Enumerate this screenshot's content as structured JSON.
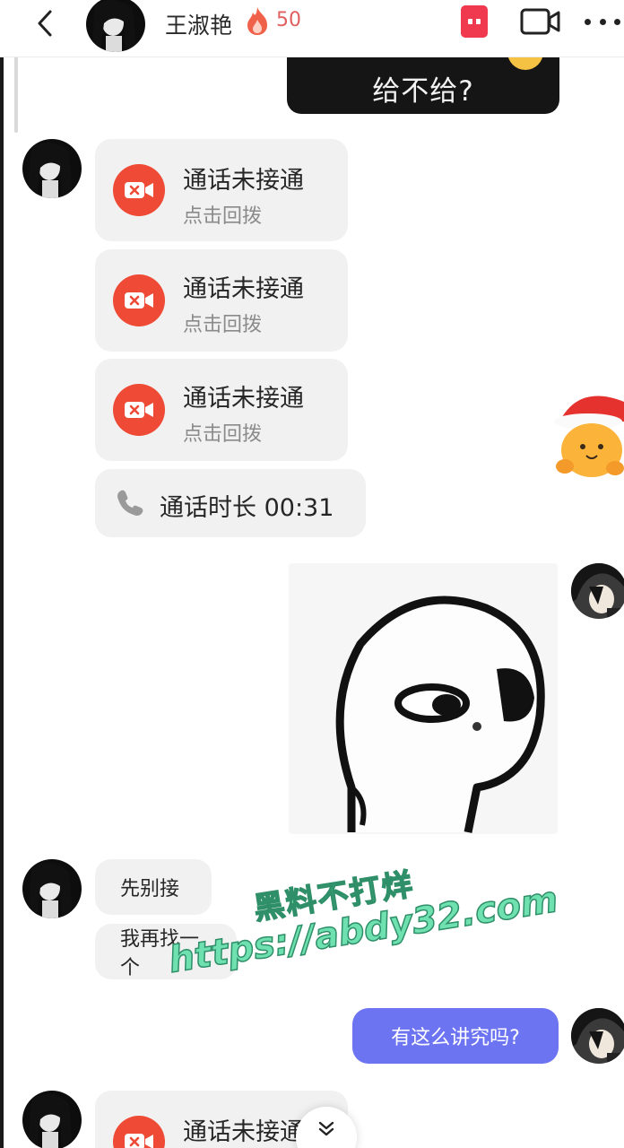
{
  "header": {
    "contact_name": "王淑艳",
    "streak_count": "50",
    "icons": [
      "back-icon",
      "fire-icon",
      "red-packet-icon",
      "video-call-icon",
      "more-icon"
    ]
  },
  "messages": {
    "outgoing_dark": "给不给?",
    "missed_call_title": "通话未接通",
    "missed_call_sub": "点击回拨",
    "duration_label": "通话时长 00:31",
    "incoming_text_1": "先别接",
    "incoming_text_2": "我再找一个",
    "outgoing_text": "有这么讲究吗?",
    "last_missed_call_title": "通话未接通"
  },
  "watermark": {
    "line1": "黑料不打烊",
    "line2": "https://abdy32.com"
  },
  "colors": {
    "call_red": "#ee4a35",
    "outgoing_bubble": "#6d74f2",
    "incoming_bubble": "#f1f1f1",
    "dark_bubble": "#151515"
  }
}
